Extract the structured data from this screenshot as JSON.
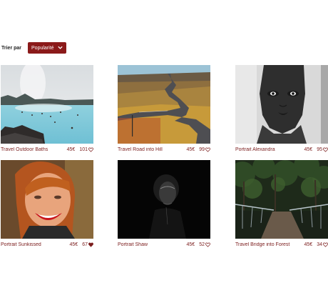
{
  "sort": {
    "label": "Trier par",
    "selected": "Popularité"
  },
  "accent": "#8b1a1a",
  "items": [
    {
      "title": "Travel Outdoor Baths",
      "price": "45€",
      "likes": "101",
      "liked": false
    },
    {
      "title": "Travel Road into Hill",
      "price": "45€",
      "likes": "99",
      "liked": false
    },
    {
      "title": "Portrait Alexandra",
      "price": "45€",
      "likes": "95",
      "liked": false
    },
    {
      "title": "Portrait Sunkissed",
      "price": "45€",
      "likes": "67",
      "liked": true
    },
    {
      "title": "Portrait Shaw",
      "price": "45€",
      "likes": "52",
      "liked": false
    },
    {
      "title": "Travel Bridge into Forest",
      "price": "45€",
      "likes": "34",
      "liked": false
    }
  ]
}
